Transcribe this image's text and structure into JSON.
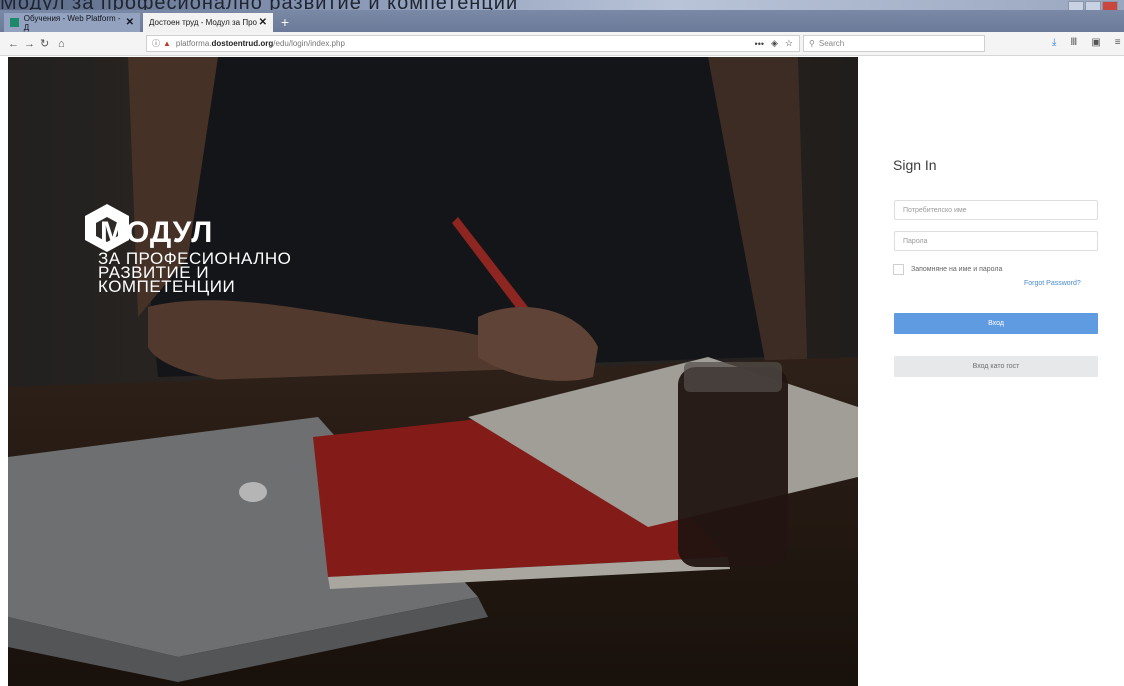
{
  "browser": {
    "tabs": [
      {
        "label": "Обучения - Web Platform - Д"
      },
      {
        "label": "Достоен труд - Модул за Про"
      }
    ],
    "url": {
      "prefix": "platforma.",
      "domain": "dostoentrud.org",
      "path": "/edu/login/index.php"
    },
    "search_placeholder": "Search",
    "ghost_title": "Модул за професионално развитие и компетенции"
  },
  "brand": {
    "name": "МОДУЛ",
    "tagline_lines": [
      "ЗА ПРОФЕСИОНАЛНО",
      "РАЗВИТИЕ И",
      "КОМПЕТЕНЦИИ"
    ]
  },
  "login": {
    "title": "Sign In",
    "username_placeholder": "Потребителско име",
    "password_placeholder": "Парола",
    "remember_label": "Запомняне на име и парола",
    "forgot_label": "Forgot Password?",
    "login_button": "Вход",
    "guest_button": "Вход като гост"
  },
  "colors": {
    "accent": "#5f9be0",
    "guest_bg": "#e6e8ea",
    "link": "#4a8bd0"
  }
}
